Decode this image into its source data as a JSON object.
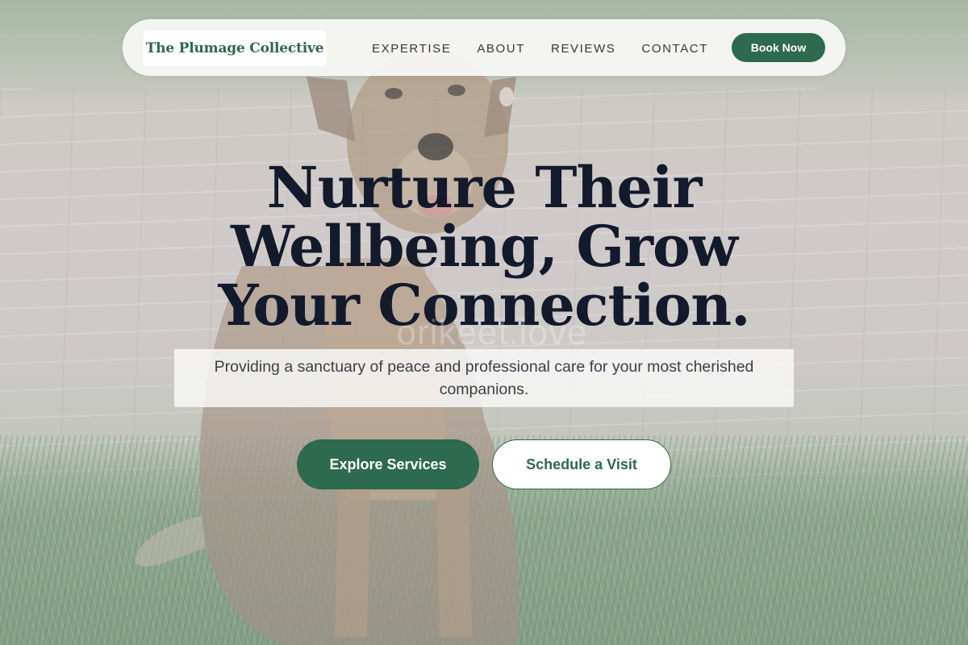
{
  "brand": {
    "name": "The Plumage Collective"
  },
  "nav": {
    "links": [
      "EXPERTISE",
      "ABOUT",
      "REVIEWS",
      "CONTACT"
    ],
    "cta_label": "Book Now"
  },
  "hero": {
    "headline": "Nurture Their Wellbeing, Grow Your Connection.",
    "watermark": "orikeet.love",
    "subtitle": "Providing a sanctuary of peace and professional care for your most cherished companions.",
    "primary_cta": "Explore Services",
    "secondary_cta": "Schedule a Visit",
    "background_image": "dog-sitting-on-grass-photo"
  },
  "colors": {
    "accent": "#2d6a4f",
    "headline": "#121a2b",
    "nav_bg": "#f8f8f6"
  }
}
